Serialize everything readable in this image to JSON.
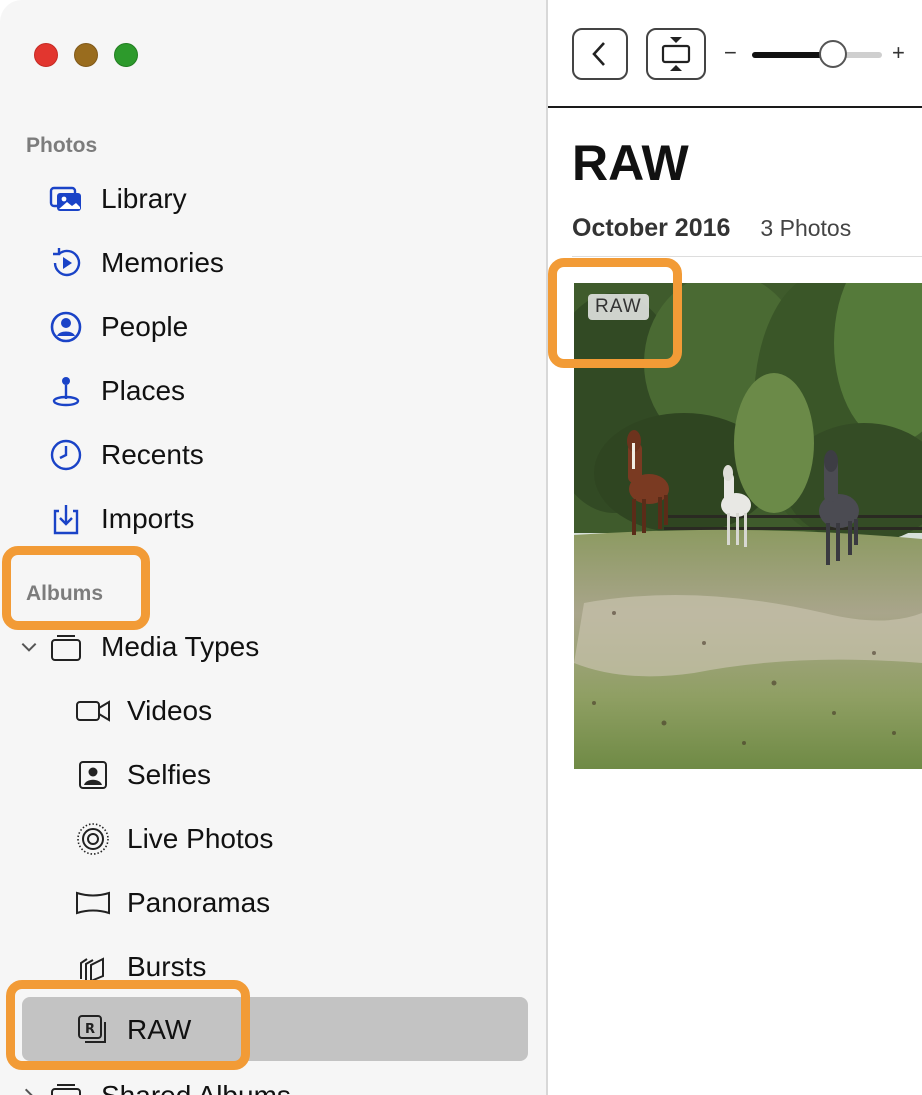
{
  "sidebar": {
    "sections": {
      "photos": "Photos",
      "albums": "Albums"
    },
    "photos_items": [
      {
        "label": "Library",
        "icon": "library-icon"
      },
      {
        "label": "Memories",
        "icon": "memories-icon"
      },
      {
        "label": "People",
        "icon": "people-icon"
      },
      {
        "label": "Places",
        "icon": "places-icon"
      },
      {
        "label": "Recents",
        "icon": "recents-icon"
      },
      {
        "label": "Imports",
        "icon": "imports-icon"
      }
    ],
    "media_types": {
      "label": "Media Types",
      "children": [
        {
          "label": "Videos",
          "icon": "video-camera-icon"
        },
        {
          "label": "Selfies",
          "icon": "selfie-icon"
        },
        {
          "label": "Live Photos",
          "icon": "live-photo-icon"
        },
        {
          "label": "Panoramas",
          "icon": "panorama-icon"
        },
        {
          "label": "Bursts",
          "icon": "bursts-icon"
        },
        {
          "label": "RAW",
          "icon": "raw-icon",
          "selected": true
        }
      ]
    },
    "shared_albums": {
      "label": "Shared Albums"
    }
  },
  "toolbar": {
    "zoom_minus": "−",
    "zoom_plus": "+",
    "zoom_level": 0.62
  },
  "main": {
    "title": "RAW",
    "date": "October 2016",
    "count": "3 Photos",
    "badge": "RAW"
  },
  "colors": {
    "accent_blue": "#1a43c7",
    "highlight_orange": "#f29b36",
    "selected_row": "#c3c3c3"
  }
}
